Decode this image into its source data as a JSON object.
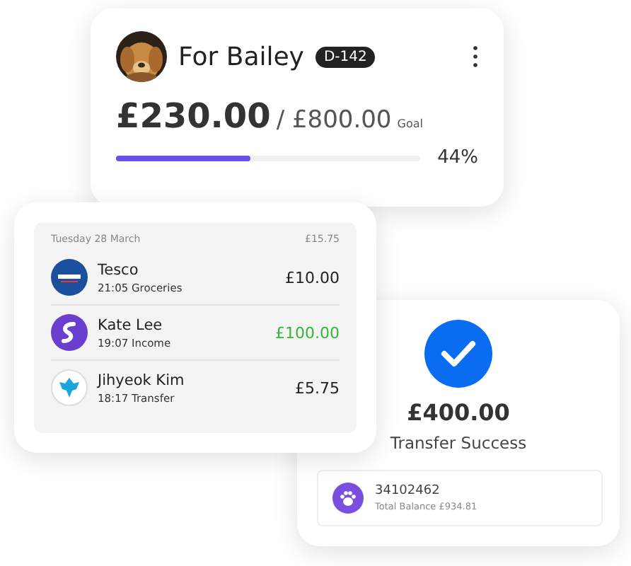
{
  "goal_card": {
    "title": "For Bailey",
    "badge": "D-142",
    "amount": "£230.00",
    "target": "/ £800.00",
    "target_label": "Goal",
    "level": 0.44,
    "percent": "44%"
  },
  "transactions_card": {
    "date": "Tuesday 28 March",
    "total": "£15.75",
    "items": [
      {
        "name": "Tesco",
        "detail": "21:05 Groceries",
        "amount": "£10.00",
        "kind": "expense",
        "logo": {
          "kind": "tesco"
        }
      },
      {
        "name": "Kate Lee",
        "detail": "19:07 Income",
        "amount": "£100.00",
        "kind": "income",
        "logo": {
          "kind": "swirl"
        }
      },
      {
        "name": "Jihyeok Kim",
        "detail": "18:17 Transfer",
        "amount": "£5.75",
        "kind": "expense",
        "logo": {
          "kind": "eagle"
        }
      }
    ]
  },
  "transfer_card": {
    "amount": "£400.00",
    "status": "Transfer Success",
    "account": "34102462",
    "balance": "Total Balance £934.81"
  }
}
